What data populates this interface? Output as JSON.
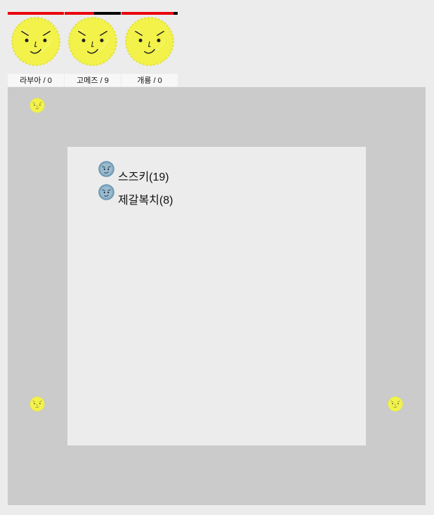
{
  "players": [
    {
      "name": "라부아",
      "score": 0,
      "label": "라부아 / 0",
      "hp": 1.0
    },
    {
      "name": "고메즈",
      "score": 9,
      "label": "고메즈 / 9",
      "hp": 0.53
    },
    {
      "name": "개룡",
      "score": 0,
      "label": "개룡 / 0",
      "hp": 0.92
    }
  ],
  "log": [
    {
      "text": "스즈키(19)",
      "icon": "blue-face-icon"
    },
    {
      "text": "제갈복치(8)",
      "icon": "blue-face-icon"
    }
  ],
  "colors": {
    "hp": "#e8000b",
    "hp_empty": "#000000",
    "face": "#f2f24a",
    "log_face": "#7fa8c0",
    "board": "#cbcbcb",
    "inner": "#ececec"
  }
}
